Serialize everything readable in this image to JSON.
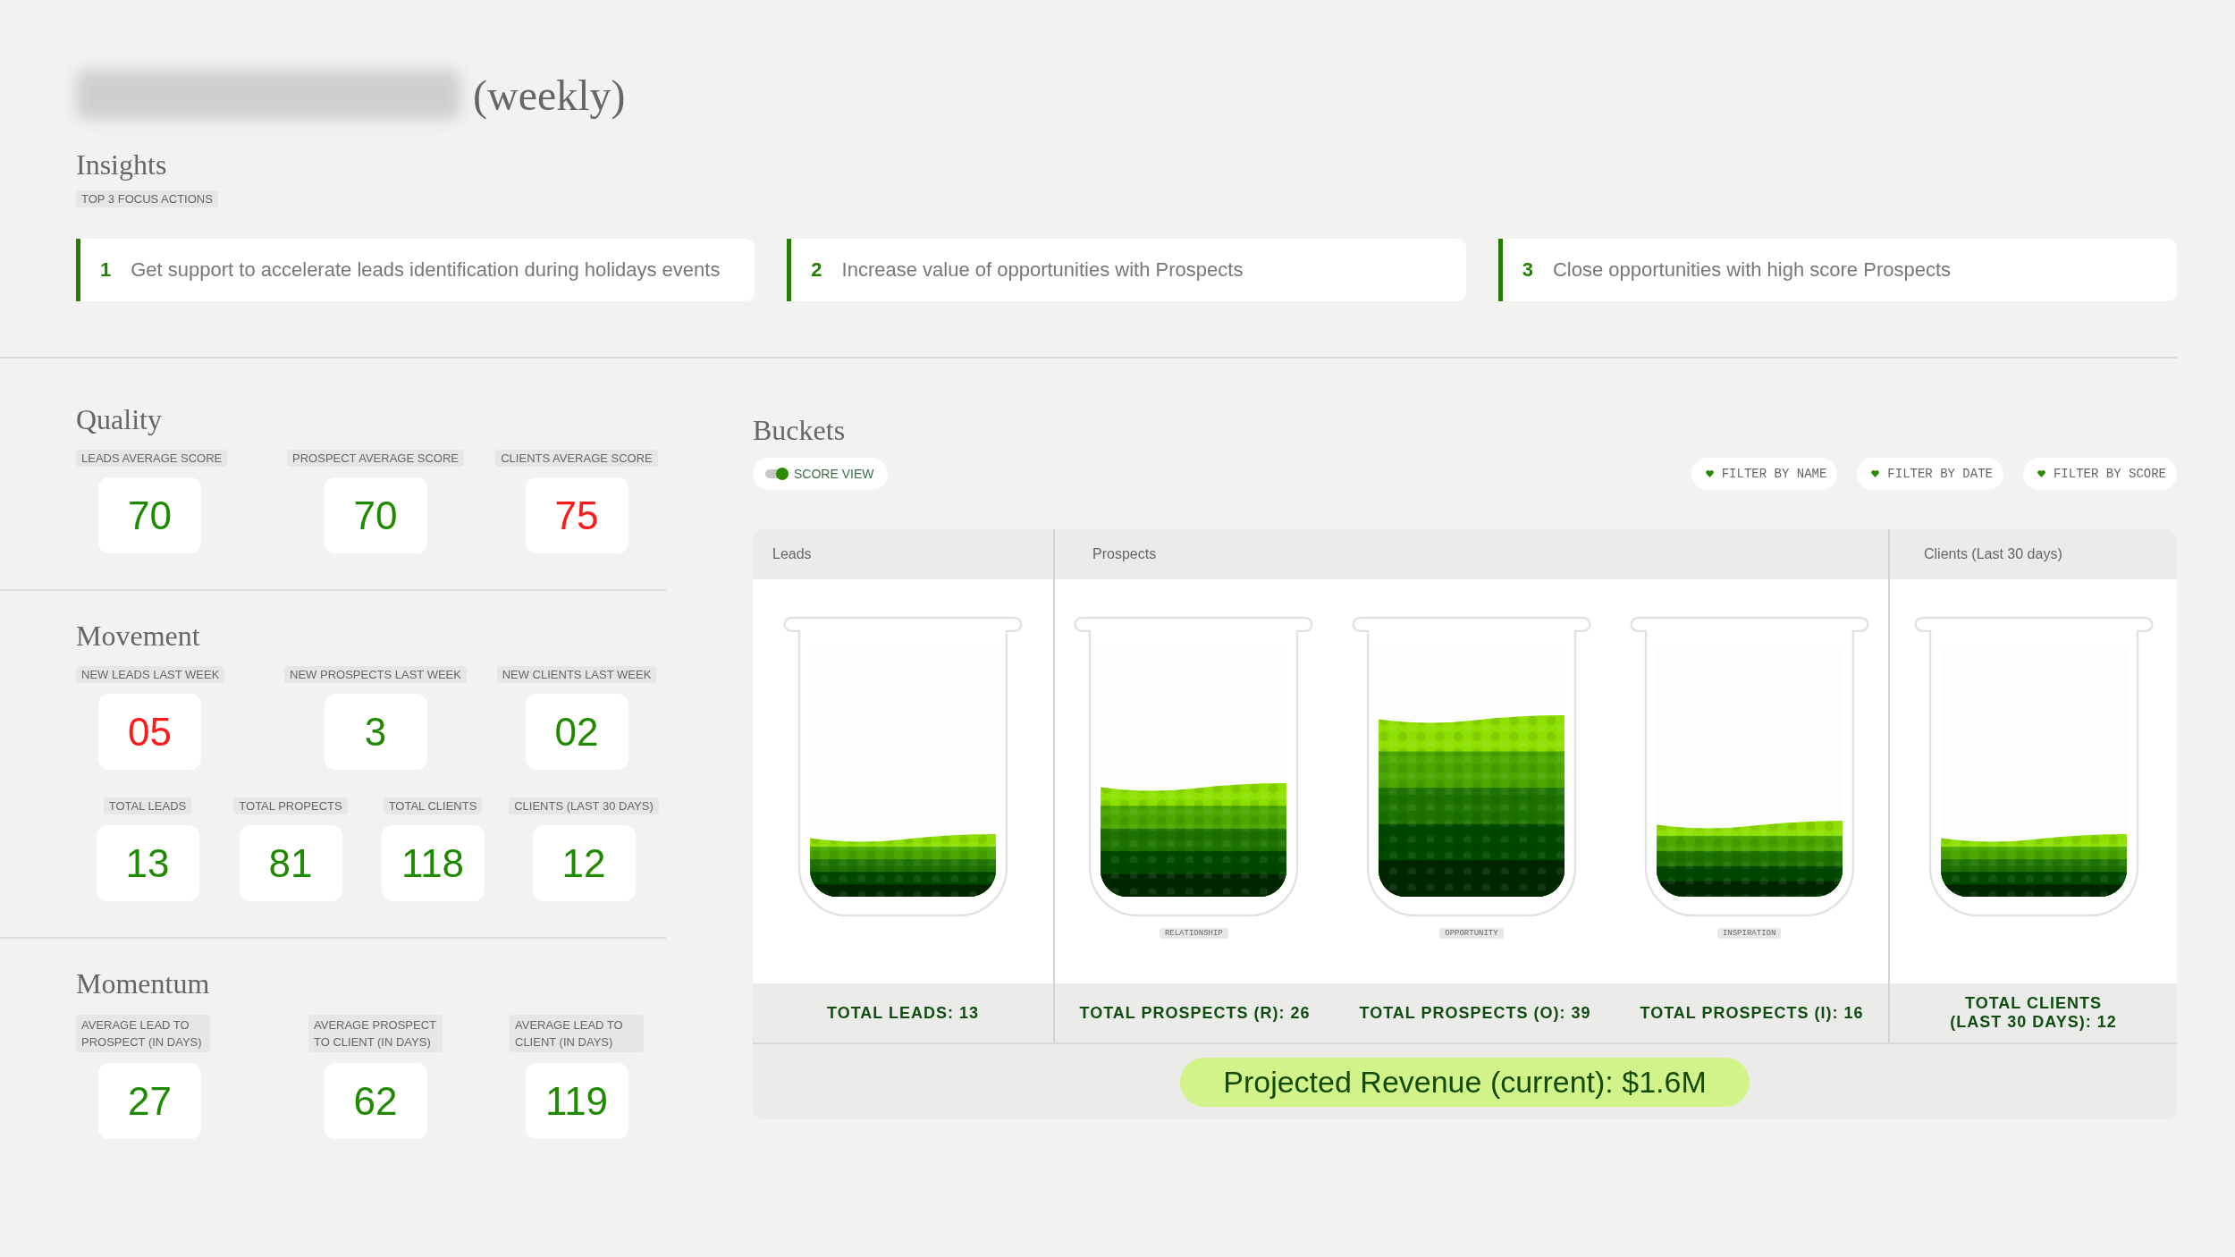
{
  "header": {
    "title_suffix": "(weekly)"
  },
  "insights": {
    "title": "Insights",
    "tag": "TOP 3 FOCUS ACTIONS",
    "actions": [
      {
        "number": "1",
        "text": "Get support to accelerate leads identification during holidays events"
      },
      {
        "number": "2",
        "text": "Increase value of opportunities with Prospects"
      },
      {
        "number": "3",
        "text": "Close opportunities with high score Prospects"
      }
    ]
  },
  "quality": {
    "title": "Quality",
    "rows": [
      {
        "metrics": [
          {
            "label": "LEADS AVERAGE SCORE",
            "value": "70",
            "color": "#1f8a00"
          },
          {
            "label": "PROSPECT AVERAGE SCORE",
            "value": "70",
            "color": "#1f8a00"
          },
          {
            "label": "CLIENTS AVERAGE SCORE",
            "value": "75",
            "color": "#ff1a1a"
          }
        ]
      }
    ]
  },
  "movement": {
    "title": "Movement",
    "rows": [
      {
        "metrics": [
          {
            "label": "NEW LEADS LAST WEEK",
            "value": "05",
            "color": "#ff1a1a"
          },
          {
            "label": "NEW PROSPECTS LAST WEEK",
            "value": "3",
            "color": "#1f8a00"
          },
          {
            "label": "NEW CLIENTS LAST WEEK",
            "value": "02",
            "color": "#1f8a00"
          }
        ]
      },
      {
        "metrics": [
          {
            "label": "TOTAL LEADS",
            "value": "13",
            "color": "#1f8a00"
          },
          {
            "label": "TOTAL PROPECTS",
            "value": "81",
            "color": "#1f8a00"
          },
          {
            "label": "TOTAL CLIENTS",
            "value": "118",
            "color": "#1f8a00"
          },
          {
            "label": "CLIENTS (LAST 30 DAYS)",
            "value": "12",
            "color": "#1f8a00"
          }
        ]
      }
    ]
  },
  "momentum": {
    "title": "Momentum",
    "rows": [
      {
        "metrics": [
          {
            "label": "AVERAGE LEAD TO PROSPECT (IN DAYS)",
            "value": "27",
            "color": "#1f8a00"
          },
          {
            "label": "AVERAGE PROSPECT TO CLIENT (IN DAYS)",
            "value": "62",
            "color": "#1f8a00"
          },
          {
            "label": "AVERAGE LEAD TO CLIENT (IN DAYS)",
            "value": "119",
            "color": "#1f8a00"
          }
        ]
      }
    ]
  },
  "buckets": {
    "title": "Buckets",
    "score_view": {
      "label": "SCORE VIEW",
      "on": true
    },
    "filters": [
      {
        "label": "FILTER BY NAME"
      },
      {
        "label": "FILTER BY DATE"
      },
      {
        "label": "FILTER BY SCORE"
      }
    ],
    "groups": [
      {
        "header": "Leads",
        "beakers": [
          {
            "level": 0.25,
            "total": "TOTAL LEADS: 13"
          }
        ]
      },
      {
        "header": "Prospects",
        "beakers": [
          {
            "level": 0.45,
            "caption": "RELATIONSHIP",
            "total": "TOTAL PROSPECTS (R): 26"
          },
          {
            "level": 0.72,
            "caption": "OPPORTUNITY",
            "total": "TOTAL PROSPECTS (O): 39"
          },
          {
            "level": 0.3,
            "caption": "INSPIRATION",
            "total": "TOTAL PROSPECTS (I): 16"
          }
        ]
      },
      {
        "header": "Clients (Last 30 days)",
        "beakers": [
          {
            "level": 0.25,
            "total": "TOTAL CLIENTS (LAST 30 DAYS): 12"
          }
        ]
      }
    ],
    "revenue": "Projected Revenue (current): $1.6M"
  }
}
